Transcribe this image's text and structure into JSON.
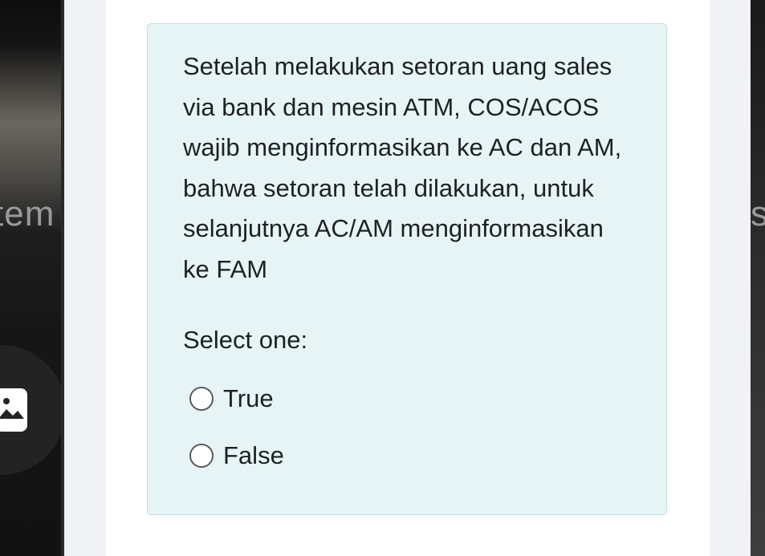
{
  "background": {
    "left_partial_text": "tem",
    "right_partial_text": "s",
    "left_icon": "image-icon"
  },
  "question": {
    "text": "Setelah melakukan setoran uang sales via bank dan mesin ATM, COS/ACOS wajib menginformasikan ke AC dan AM, bahwa setoran telah dilakukan, untuk selanjutnya AC/AM menginformasikan ke FAM",
    "prompt": "Select one:",
    "options": [
      {
        "label": "True",
        "selected": false
      },
      {
        "label": "False",
        "selected": false
      }
    ]
  },
  "colors": {
    "question_bg": "#e7f4f5",
    "question_border": "#bfdfe4",
    "text": "#1d2125"
  }
}
